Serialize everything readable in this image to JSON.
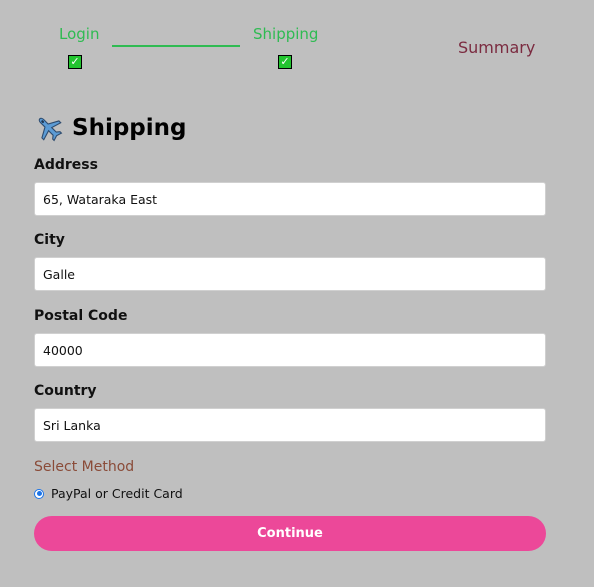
{
  "steps": {
    "login": {
      "label": "Login",
      "completed": true
    },
    "shipping": {
      "label": "Shipping",
      "completed": true
    },
    "summary": {
      "label": "Summary",
      "completed": false
    },
    "check_glyph": "✓"
  },
  "form": {
    "icon": "airplane-icon",
    "title": "Shipping",
    "address": {
      "label": "Address",
      "value": "65, Wataraka East"
    },
    "city": {
      "label": "City",
      "value": "Galle"
    },
    "postal_code": {
      "label": "Postal Code",
      "value": "40000"
    },
    "country": {
      "label": "Country",
      "value": "Sri Lanka"
    },
    "payment": {
      "legend": "Select Method",
      "option_label": "PayPal or Credit Card",
      "selected": true
    },
    "submit_label": "Continue"
  },
  "colors": {
    "background": "#bfbfbf",
    "step_done": "#2fbb52",
    "step_pending": "#7b2b40",
    "legend": "#8a4b38",
    "button": "#ec4899",
    "radio": "#1a73e8"
  }
}
